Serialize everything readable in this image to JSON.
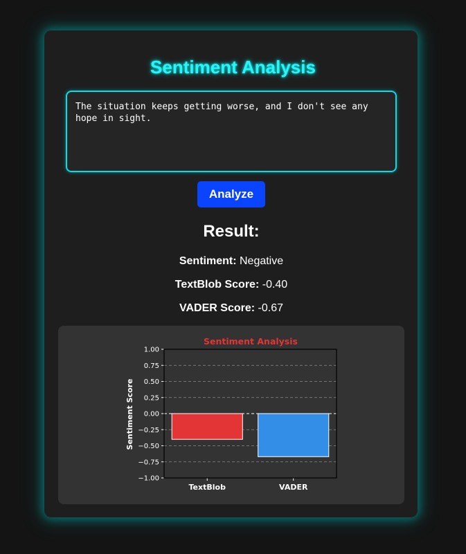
{
  "app": {
    "title": "Sentiment Analysis",
    "input_text": "The situation keeps getting worse, and I don't see any hope in sight.",
    "analyze_label": "Analyze",
    "result_heading": "Result:",
    "results": [
      {
        "label": "Sentiment:",
        "value": "Negative"
      },
      {
        "label": "TextBlob Score:",
        "value": "-0.40"
      },
      {
        "label": "VADER Score:",
        "value": "-0.67"
      }
    ]
  },
  "colors": {
    "accent": "#2ef2f5",
    "button": "#0a44ff",
    "textblob_bar": "#e33535",
    "vader_bar": "#338ee8",
    "chart_title": "#e33535"
  },
  "chart_data": {
    "type": "bar",
    "title": "Sentiment Analysis",
    "xlabel": "",
    "ylabel": "Sentiment Score",
    "categories": [
      "TextBlob",
      "VADER"
    ],
    "values": [
      -0.4,
      -0.67
    ],
    "ylim": [
      -1.0,
      1.0
    ],
    "yticks": [
      "1.00",
      "0.75",
      "0.50",
      "0.25",
      "0.00",
      "−0.25",
      "−0.50",
      "−0.75",
      "−1.00"
    ],
    "grid": true
  }
}
